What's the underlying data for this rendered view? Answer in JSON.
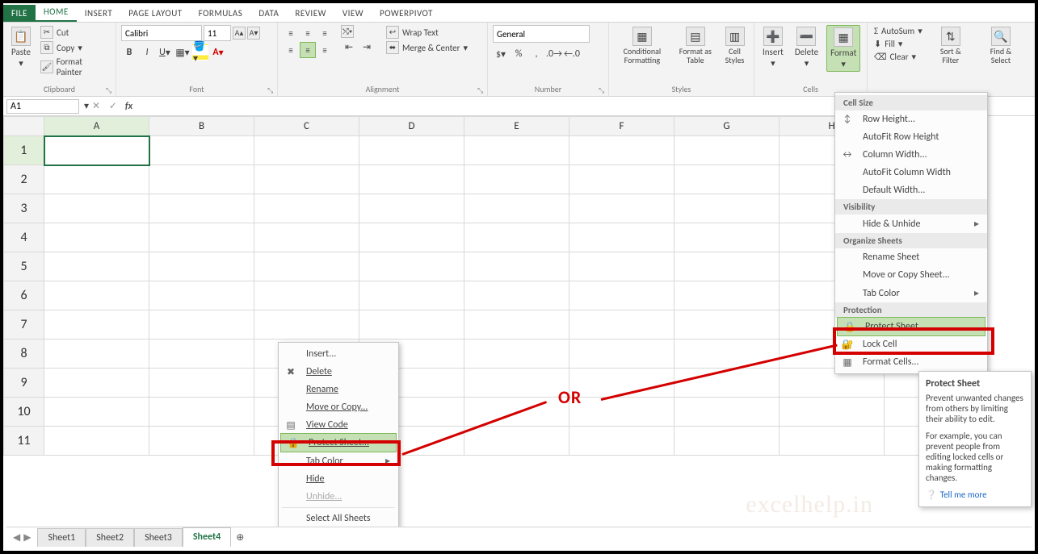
{
  "tabs": {
    "file": "FILE",
    "home": "HOME",
    "insert": "INSERT",
    "page_layout": "PAGE LAYOUT",
    "formulas": "FORMULAS",
    "data": "DATA",
    "review": "REVIEW",
    "view": "VIEW",
    "powerpivot": "POWERPIVOT"
  },
  "clipboard": {
    "paste": "Paste",
    "cut": "Cut",
    "copy": "Copy",
    "format_painter": "Format Painter",
    "group": "Clipboard"
  },
  "font": {
    "name": "Calibri",
    "size": "11",
    "group": "Font"
  },
  "alignment": {
    "wrap": "Wrap Text",
    "merge": "Merge & Center",
    "group": "Alignment"
  },
  "number": {
    "format": "General",
    "group": "Number"
  },
  "styles": {
    "cond": "Conditional Formatting",
    "table": "Format as Table",
    "cellstyles": "Cell Styles",
    "group": "Styles"
  },
  "cells": {
    "insert": "Insert",
    "delete": "Delete",
    "format": "Format",
    "group": "Cells"
  },
  "editing": {
    "autosum": "AutoSum",
    "fill": "Fill",
    "clear": "Clear",
    "sort": "Sort & Filter",
    "find": "Find & Select"
  },
  "namebox": "A1",
  "columns": [
    "A",
    "B",
    "C",
    "D",
    "E",
    "F",
    "G",
    "H"
  ],
  "rows": [
    "1",
    "2",
    "3",
    "4",
    "5",
    "6",
    "7",
    "8",
    "9",
    "10",
    "11"
  ],
  "sheettabs": {
    "s1": "Sheet1",
    "s2": "Sheet2",
    "s3": "Sheet3",
    "s4": "Sheet4"
  },
  "ctxmenu": {
    "insert": "Insert...",
    "delete": "Delete",
    "rename": "Rename",
    "move": "Move or Copy...",
    "viewcode": "View Code",
    "protect": "Protect Sheet...",
    "tabcolor": "Tab Color",
    "hide": "Hide",
    "unhide": "Unhide...",
    "selectall": "Select All Sheets"
  },
  "fmtmenu": {
    "hdr_cellsize": "Cell Size",
    "rowheight": "Row Height...",
    "autofitrow": "AutoFit Row Height",
    "colwidth": "Column Width...",
    "autofitcol": "AutoFit Column Width",
    "defwidth": "Default Width...",
    "hdr_visibility": "Visibility",
    "hideunhide": "Hide & Unhide",
    "hdr_organize": "Organize Sheets",
    "rename": "Rename Sheet",
    "movecopy": "Move or Copy Sheet...",
    "tabcolor": "Tab Color",
    "hdr_protection": "Protection",
    "protect": "Protect Sheet...",
    "lock": "Lock Cell",
    "fmtcells": "Format Cells..."
  },
  "tooltip": {
    "title": "Protect Sheet",
    "line1": "Prevent unwanted changes from others by limiting their ability to edit.",
    "line2": "For example, you can prevent people from editing locked cells or making formatting changes.",
    "link": "Tell me more"
  },
  "annotation": {
    "or": "OR"
  },
  "watermark": "excelhelp.in"
}
